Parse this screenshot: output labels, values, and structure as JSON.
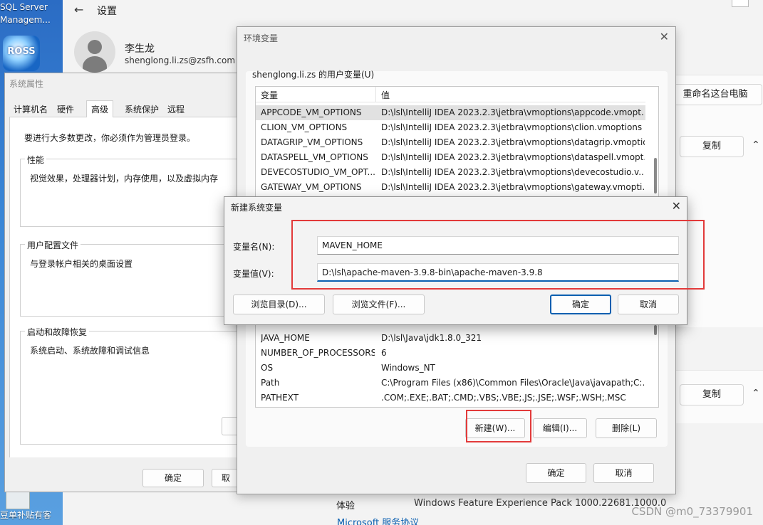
{
  "desktop": {
    "icon_label_1": "SQL Server",
    "icon_label_2": "Managem...",
    "icon_badge": "ROSS",
    "bottom_label": "豆单补贴有客"
  },
  "settings": {
    "title": "设置",
    "user_name": "李生龙",
    "user_email": "shenglong.li.zs@zsfh.com",
    "rename_button": "重命名这台电脑",
    "copy_button_1": "复制",
    "copy_button_2": "复制",
    "experience_label": "体验",
    "experience_value": "Windows Feature Experience Pack 1000.22681.1000.0",
    "service_link": "Microsoft 服务协议",
    "watermark": "CSDN @m0_73379901"
  },
  "sysprops": {
    "title": "系统属性",
    "tabs": [
      "计算机名",
      "硬件",
      "高级",
      "系统保护",
      "远程"
    ],
    "active_tab": "高级",
    "notice": "要进行大多数更改，你必须作为管理员登录。",
    "groups": [
      {
        "title": "性能",
        "desc": "视觉效果，处理器计划，内存使用，以及虚拟内存"
      },
      {
        "title": "用户配置文件",
        "desc": "与登录帐户相关的桌面设置"
      },
      {
        "title": "启动和故障恢复",
        "desc": "系统启动、系统故障和调试信息"
      }
    ],
    "ok_button": "确定",
    "cancel_button_partial": "取"
  },
  "envvars": {
    "title": "环境变量",
    "user_group_label": "shenglong.li.zs 的用户变量(U)",
    "columns": [
      "变量",
      "值"
    ],
    "user_vars": [
      {
        "name": "APPCODE_VM_OPTIONS",
        "value": "D:\\lsl\\IntelliJ IDEA 2023.2.3\\jetbra\\vmoptions\\appcode.vmopt..."
      },
      {
        "name": "CLION_VM_OPTIONS",
        "value": "D:\\lsl\\IntelliJ IDEA 2023.2.3\\jetbra\\vmoptions\\clion.vmoptions"
      },
      {
        "name": "DATAGRIP_VM_OPTIONS",
        "value": "D:\\lsl\\IntelliJ IDEA 2023.2.3\\jetbra\\vmoptions\\datagrip.vmoptio..."
      },
      {
        "name": "DATASPELL_VM_OPTIONS",
        "value": "D:\\lsl\\IntelliJ IDEA 2023.2.3\\jetbra\\vmoptions\\dataspell.vmopt..."
      },
      {
        "name": "DEVECOSTUDIO_VM_OPT...",
        "value": "D:\\lsl\\IntelliJ IDEA 2023.2.3\\jetbra\\vmoptions\\devecostudio.v..."
      },
      {
        "name": "GATEWAY_VM_OPTIONS",
        "value": "D:\\lsl\\IntelliJ IDEA 2023.2.3\\jetbra\\vmoptions\\gateway.vmopti..."
      }
    ],
    "system_vars": [
      {
        "name": "JAVA_HOME",
        "value": "D:\\lsl\\Java\\jdk1.8.0_321"
      },
      {
        "name": "NUMBER_OF_PROCESSORS",
        "value": "6"
      },
      {
        "name": "OS",
        "value": "Windows_NT"
      },
      {
        "name": "Path",
        "value": "C:\\Program Files (x86)\\Common Files\\Oracle\\Java\\javapath;C:..."
      },
      {
        "name": "PATHEXT",
        "value": ".COM;.EXE;.BAT;.CMD;.VBS;.VBE;.JS;.JSE;.WSF;.WSH;.MSC"
      }
    ],
    "new_button": "新建(W)...",
    "edit_button": "编辑(I)...",
    "delete_button": "删除(L)",
    "ok_button": "确定",
    "cancel_button": "取消"
  },
  "newvar": {
    "title": "新建系统变量",
    "name_label": "变量名(N):",
    "value_label": "变量值(V):",
    "name_value": "MAVEN_HOME",
    "value_value": "D:\\lsl\\apache-maven-3.9.8-bin\\apache-maven-3.9.8",
    "browse_dir_button": "浏览目录(D)...",
    "browse_file_button": "浏览文件(F)...",
    "ok_button": "确定",
    "cancel_button": "取消"
  },
  "colors": {
    "accent": "#0a5fb0",
    "highlight_red": "#e23a3a"
  }
}
